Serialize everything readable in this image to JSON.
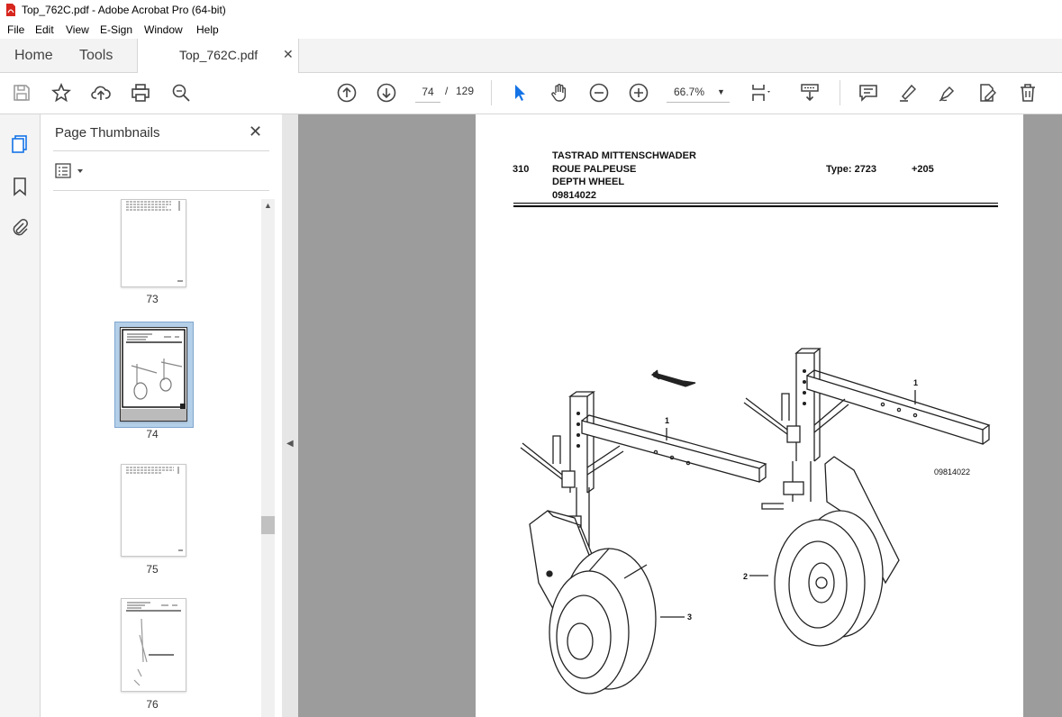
{
  "window": {
    "title": "Top_762C.pdf - Adobe Acrobat Pro (64-bit)"
  },
  "menu": [
    "File",
    "Edit",
    "View",
    "E-Sign",
    "Window",
    "Help"
  ],
  "tabs": {
    "home": "Home",
    "tools": "Tools",
    "document": "Top_762C.pdf"
  },
  "toolbar": {
    "current_page": "74",
    "page_separator": "/",
    "total_pages": "129",
    "zoom": "66.7%"
  },
  "panel": {
    "title": "Page Thumbnails",
    "thumbnails": [
      {
        "label": "73",
        "selected": false
      },
      {
        "label": "74",
        "selected": true
      },
      {
        "label": "75",
        "selected": false
      },
      {
        "label": "76",
        "selected": false
      }
    ]
  },
  "document_page": {
    "section": "310",
    "title_de": "TASTRAD MITTENSCHWADER",
    "title_fr": "ROUE PALPEUSE",
    "title_en": "DEPTH WHEEL",
    "part_number": "09814022",
    "type_label": "Type: 2723",
    "serial": "+205",
    "figure_id": "09814022",
    "callouts": [
      "1",
      "1",
      "2",
      "3"
    ]
  },
  "colors": {
    "accent_blue": "#1473e6",
    "doc_background": "#9c9c9c"
  }
}
